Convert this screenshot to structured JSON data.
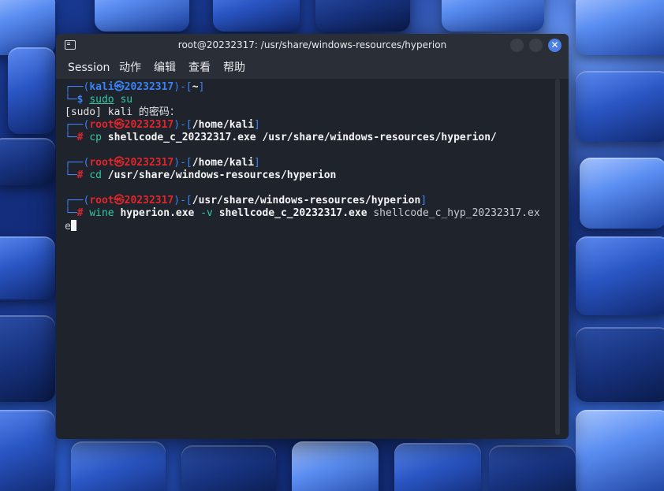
{
  "window": {
    "title": "root@20232317: /usr/share/windows-resources/hyperion"
  },
  "menu": {
    "items": [
      "Session",
      "动作",
      "编辑",
      "查看",
      "帮助"
    ]
  },
  "terminal": {
    "prompt1": {
      "user": "kali",
      "at": "㉿",
      "host": "20232317",
      "dir": "~",
      "symbol": "$",
      "command": "sudo",
      "args": " su"
    },
    "sudo_prompt": "[sudo] kali 的密码：",
    "prompt2": {
      "user": "root",
      "at": "㉿",
      "host": "20232317",
      "dir": "/home/kali",
      "symbol": "#",
      "command": "cp",
      "args": "shellcode_c_20232317.exe /usr/share/windows-resources/hyperion/"
    },
    "prompt3": {
      "user": "root",
      "at": "㉿",
      "host": "20232317",
      "dir": "/home/kali",
      "symbol": "#",
      "command": "cd",
      "args": "/usr/share/windows-resources/hyperion"
    },
    "prompt4": {
      "user": "root",
      "at": "㉿",
      "host": "20232317",
      "dir": "/usr/share/windows-resources/hyperion",
      "symbol": "#",
      "command": "wine",
      "arg1": "hyperion.exe",
      "flag": "-v",
      "arg2": "shellcode_c_20232317.exe",
      "arg3": "shellcode_c_hyp_20232317.ex",
      "wrap": "e"
    }
  },
  "colors": {
    "accent": "#3b82f6",
    "root_red": "#e0262c",
    "command_teal": "#33c8a8",
    "background": "#1f232b"
  }
}
